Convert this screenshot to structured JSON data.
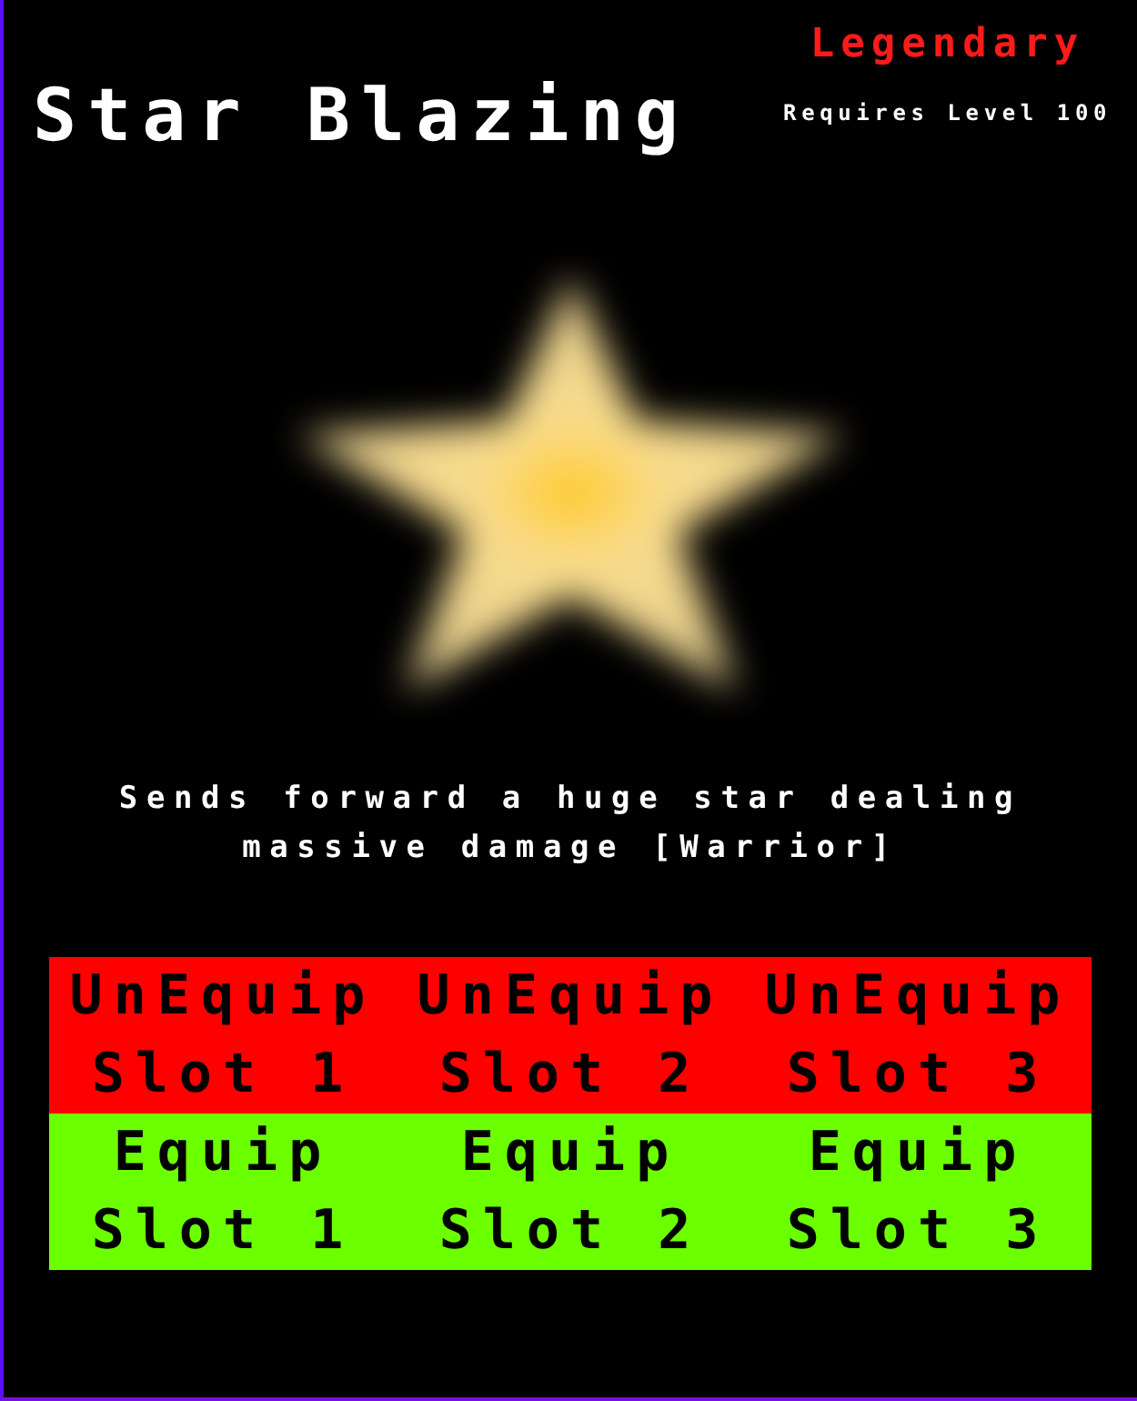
{
  "item": {
    "name": "Star Blazing",
    "rarity": "Legendary",
    "requirement": "Requires Level 100",
    "description": "Sends forward a huge star dealing massive damage [Warrior]"
  },
  "slot_actions": [
    {
      "kind": "unequip",
      "buttons": [
        "UnEquip Slot 1",
        "UnEquip Slot 2",
        "UnEquip Slot 3"
      ]
    },
    {
      "kind": "equip",
      "buttons": [
        "Equip Slot 1",
        "Equip Slot 2",
        "Equip Slot 3"
      ]
    }
  ]
}
